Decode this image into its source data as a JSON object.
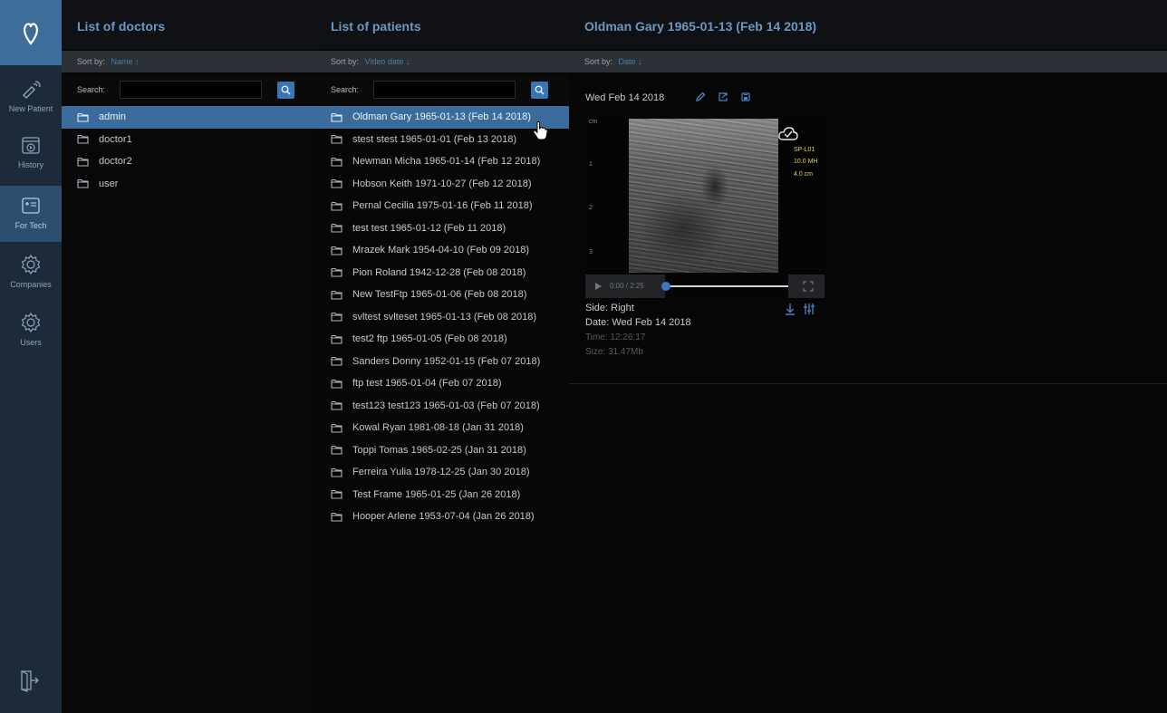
{
  "nav": {
    "items": [
      {
        "label": "New Patient",
        "icon": "probe-icon"
      },
      {
        "label": "History",
        "icon": "history-video-icon"
      },
      {
        "label": "For Tech",
        "icon": "tech-list-icon",
        "active": true
      },
      {
        "label": "Companies",
        "icon": "gear-icon"
      },
      {
        "label": "Users",
        "icon": "gear-icon"
      }
    ]
  },
  "doctors": {
    "title": "List of doctors",
    "sort_prefix": "Sort by:",
    "sort_value": "Name ↑",
    "search_label": "Search:",
    "search_value": "",
    "items": [
      "admin",
      "doctor1",
      "doctor2",
      "user"
    ],
    "selected_index": 0
  },
  "patients": {
    "title": "List of patients",
    "sort_prefix": "Sort by:",
    "sort_value": "Video date ↓",
    "search_label": "Search:",
    "search_value": "",
    "items": [
      "Oldman Gary 1965-01-13 (Feb 14 2018)",
      "stest stest 1965-01-01 (Feb 13 2018)",
      "Newman Micha 1965-01-14 (Feb 12 2018)",
      "Hobson Keith 1971-10-27 (Feb 12 2018)",
      "Pernal Cecilia 1975-01-16 (Feb 11 2018)",
      "test test 1965-01-12 (Feb 11 2018)",
      "Mrazek Mark 1954-04-10 (Feb 09 2018)",
      "Pion Roland 1942-12-28 (Feb 08 2018)",
      "New TestFtp 1965-01-06 (Feb 08 2018)",
      "svltest svlteset 1965-01-13 (Feb 08 2018)",
      "test2 ftp 1965-01-05 (Feb 08 2018)",
      "Sanders Donny 1952-01-15 (Feb 07 2018)",
      "ftp test 1965-01-04 (Feb 07 2018)",
      "test123 test123 1965-01-03 (Feb 07 2018)",
      "Kowal Ryan 1981-08-18 (Jan 31 2018)",
      "Toppi Tomas 1965-02-25 (Jan 31 2018)",
      "Ferreira Yulia 1978-12-25 (Jan 30 2018)",
      "Test Frame 1965-01-25 (Jan 26 2018)",
      "Hooper Arlene 1953-07-04 (Jan 26 2018)"
    ],
    "selected_index": 0
  },
  "detail": {
    "title": "Oldman Gary 1965-01-13 (Feb 14 2018)",
    "sort_prefix": "Sort by:",
    "sort_value": "Date ↓",
    "exam_date": "Wed Feb 14 2018",
    "video": {
      "depth_unit": "cm",
      "depth_ticks": [
        "1",
        "2",
        "3"
      ],
      "probe": "SP-L01",
      "frequency": "10.0 MH",
      "depth": "4.0 cm",
      "time": "0:00 / 2:25",
      "progress": 0.0
    },
    "side": "Side: Right",
    "date": "Date: Wed Feb 14 2018",
    "time": "Time: 12:26:17",
    "size": "Size: 31.47Mb"
  },
  "colors": {
    "rail": "#1d2a3a",
    "logo": "#3d6d9b",
    "selected_row": "#3a6b9d",
    "title": "#6a98c4",
    "accent": "#3b78c0"
  }
}
